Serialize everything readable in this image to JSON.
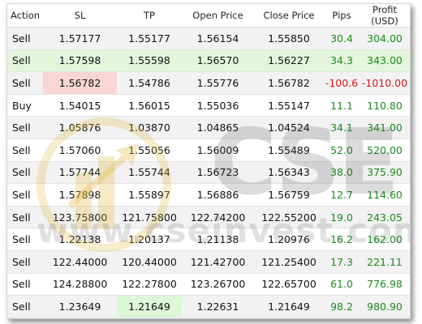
{
  "columns": [
    "Action",
    "SL",
    "TP",
    "Open Price",
    "Close Price",
    "Pips",
    "Profit (USD)"
  ],
  "rows": [
    {
      "action": "Sell",
      "sl": "1.57177",
      "tp": "1.55177",
      "open": "1.56154",
      "close": "1.55850",
      "pips": "30.4",
      "profit": "304.00"
    },
    {
      "action": "Sell",
      "sl": "1.57598",
      "tp": "1.55598",
      "open": "1.56570",
      "close": "1.56227",
      "pips": "34.3",
      "profit": "343.00"
    },
    {
      "action": "Sell",
      "sl": "1.56782",
      "tp": "1.54786",
      "open": "1.55776",
      "close": "1.56782",
      "pips": "-100.6",
      "profit": "-1010.00"
    },
    {
      "action": "Buy",
      "sl": "1.54015",
      "tp": "1.56015",
      "open": "1.55036",
      "close": "1.55147",
      "pips": "11.1",
      "profit": "110.80"
    },
    {
      "action": "Sell",
      "sl": "1.05876",
      "tp": "1.03870",
      "open": "1.04865",
      "close": "1.04524",
      "pips": "34.1",
      "profit": "341.00"
    },
    {
      "action": "Sell",
      "sl": "1.57060",
      "tp": "1.55056",
      "open": "1.56009",
      "close": "1.55489",
      "pips": "52.0",
      "profit": "520.00"
    },
    {
      "action": "Sell",
      "sl": "1.57744",
      "tp": "1.55744",
      "open": "1.56723",
      "close": "1.56343",
      "pips": "38.0",
      "profit": "375.90"
    },
    {
      "action": "Sell",
      "sl": "1.57898",
      "tp": "1.55897",
      "open": "1.56886",
      "close": "1.56759",
      "pips": "12.7",
      "profit": "114.60"
    },
    {
      "action": "Sell",
      "sl": "123.75800",
      "tp": "121.75800",
      "open": "122.74200",
      "close": "122.55200",
      "pips": "19.0",
      "profit": "243.05"
    },
    {
      "action": "Sell",
      "sl": "1.22138",
      "tp": "1.20137",
      "open": "1.21138",
      "close": "1.20976",
      "pips": "16.2",
      "profit": "162.00"
    },
    {
      "action": "Sell",
      "sl": "122.44000",
      "tp": "120.44000",
      "open": "121.42700",
      "close": "121.25400",
      "pips": "17.3",
      "profit": "221.11"
    },
    {
      "action": "Sell",
      "sl": "124.28800",
      "tp": "122.27800",
      "open": "123.26700",
      "close": "122.65700",
      "pips": "61.0",
      "profit": "776.98"
    },
    {
      "action": "Sell",
      "sl": "1.23649",
      "tp": "1.21649",
      "open": "1.22631",
      "close": "1.21649",
      "pips": "98.2",
      "profit": "980.90"
    }
  ],
  "watermark": {
    "brand": "CSE",
    "url": "www.cseinvest.com",
    "logo_icon": "cse-emblem-icon"
  },
  "colors": {
    "positive": "#1c8a1c",
    "negative": "#e01414",
    "sl_hit_highlight": "#f9d6d6",
    "tp_hit_highlight": "#def6d8",
    "row_highlight": "#e3f6dc"
  }
}
